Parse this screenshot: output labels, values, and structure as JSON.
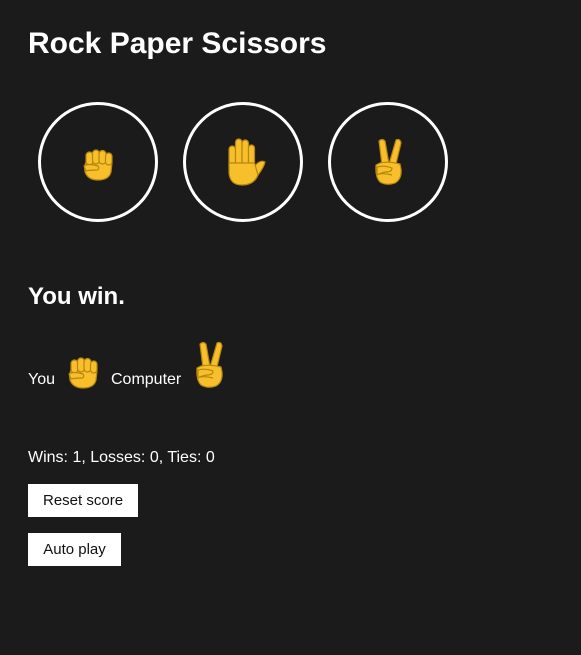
{
  "page": {
    "title": "Rock Paper Scissors"
  },
  "moves": [
    {
      "name": "rock",
      "icon": "fist-emoji-icon"
    },
    {
      "name": "paper",
      "icon": "raised-hand-emoji-icon"
    },
    {
      "name": "scissors",
      "icon": "victory-hand-emoji-icon"
    }
  ],
  "result": {
    "text": "You win."
  },
  "picks": {
    "you_label": "You",
    "you_icon": "fist-emoji-icon",
    "computer_label": "Computer",
    "computer_icon": "victory-hand-emoji-icon"
  },
  "score": {
    "text": "Wins: 1, Losses: 0, Ties: 0"
  },
  "buttons": {
    "reset": "Reset score",
    "auto_play": "Auto play"
  },
  "colors": {
    "background": "#1b1b1b",
    "text": "#ffffff",
    "emoji_fill": "#f6bf2b",
    "emoji_outline": "#b7860d"
  }
}
